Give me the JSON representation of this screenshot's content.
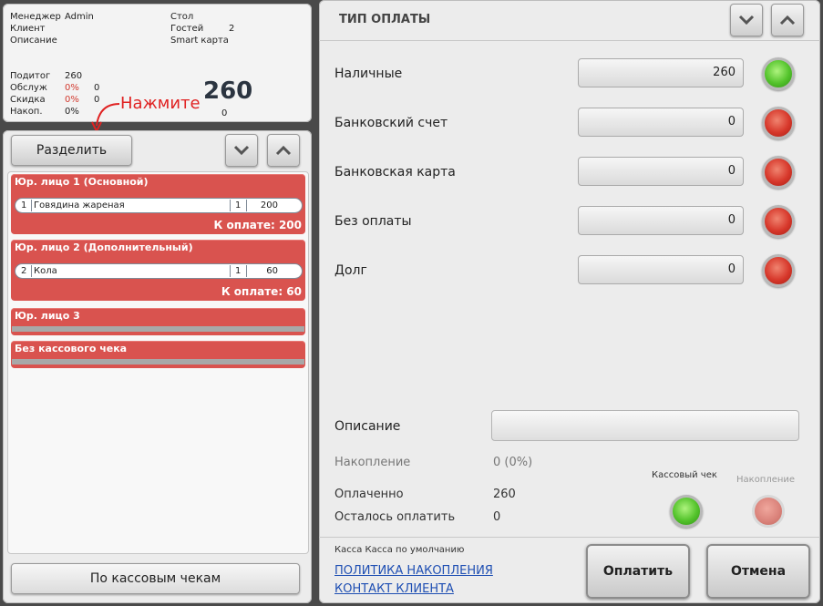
{
  "info": {
    "manager_label": "Менеджер",
    "manager_value": "Admin",
    "client_label": "Клиент",
    "description_label": "Описание",
    "table_label": "Стол",
    "guests_label": "Гостей",
    "guests_value": "2",
    "card_label": "Smart карта",
    "subtotal_label": "Подитог",
    "subtotal_value": "260",
    "service_label": "Обслуж",
    "service_pct": "0%",
    "service_value": "0",
    "discount_label": "Скидка",
    "discount_pct": "0%",
    "discount_value": "0",
    "accum_label": "Накоп.",
    "accum_pct": "0%",
    "accum_value": "0",
    "total": "260"
  },
  "callout": {
    "text": "Нажмите"
  },
  "left": {
    "split_button": "Разделить",
    "bottom_button": "По кассовым чекам",
    "entities": [
      {
        "title": "Юр. лицо 1 (Основной)",
        "item": {
          "num": "1",
          "name": "Говядина жареная",
          "qty": "1",
          "price": "200"
        },
        "total": "К оплате: 200"
      },
      {
        "title": "Юр. лицо 2 (Дополнительный)",
        "item": {
          "num": "2",
          "name": "Кола",
          "qty": "1",
          "price": "60"
        },
        "total": "К оплате: 60"
      },
      {
        "title": "Юр. лицо 3"
      },
      {
        "title": "Без кассового чека"
      }
    ]
  },
  "right": {
    "title": "ТИП ОПЛАТЫ",
    "methods": [
      {
        "label": "Наличные",
        "value": "260",
        "status": "green"
      },
      {
        "label": "Банковский счет",
        "value": "0",
        "status": "red"
      },
      {
        "label": "Банковская карта",
        "value": "0",
        "status": "red"
      },
      {
        "label": "Без оплаты",
        "value": "0",
        "status": "red"
      },
      {
        "label": "Долг",
        "value": "0",
        "status": "red"
      }
    ],
    "description_label": "Описание",
    "description_value": "",
    "accum_label": "Накопление",
    "accum_value": "0 (0%)",
    "paid_label": "Оплаченно",
    "paid_value": "260",
    "remaining_label": "Осталось оплатить",
    "remaining_value": "0",
    "receipt_label": "Кассовый чек",
    "accumulation_toggle_label": "Накопление",
    "kassa_text": "Касса  Касса по умолчанию",
    "link_policy": "ПОЛИТИКА НАКОПЛЕНИЯ",
    "link_contact": "КОНТАКТ КЛИЕНТА",
    "pay_button": "Оплатить",
    "cancel_button": "Отмена"
  },
  "colors": {
    "accent_red": "#d9534f",
    "lamp_green": "#53c32b",
    "lamp_red": "#d7382b",
    "link": "#1f4fb3"
  }
}
